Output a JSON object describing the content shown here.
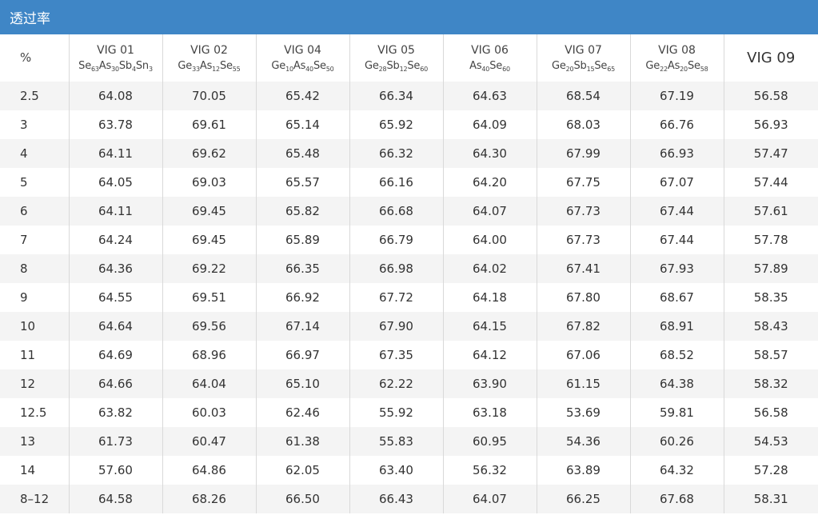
{
  "title": "透过率",
  "table": {
    "corner": "%",
    "columns": [
      {
        "name": "VIG 01",
        "formula": [
          [
            "Se",
            "63"
          ],
          [
            "As",
            "30"
          ],
          [
            "Sb",
            "4"
          ],
          [
            "Sn",
            "3"
          ]
        ]
      },
      {
        "name": "VIG 02",
        "formula": [
          [
            "Ge",
            "33"
          ],
          [
            "As",
            "12"
          ],
          [
            "Se",
            "55"
          ]
        ]
      },
      {
        "name": "VIG 04",
        "formula": [
          [
            "Ge",
            "10"
          ],
          [
            "As",
            "40"
          ],
          [
            "Se",
            "50"
          ]
        ]
      },
      {
        "name": "VIG 05",
        "formula": [
          [
            "Ge",
            "28"
          ],
          [
            "Sb",
            "12"
          ],
          [
            "Se",
            "60"
          ]
        ]
      },
      {
        "name": "VIG 06",
        "formula": [
          [
            "As",
            "40"
          ],
          [
            "Se",
            "60"
          ]
        ]
      },
      {
        "name": "VIG 07",
        "formula": [
          [
            "Ge",
            "20"
          ],
          [
            "Sb",
            "15"
          ],
          [
            "Se",
            "65"
          ]
        ]
      },
      {
        "name": "VIG 08",
        "formula": [
          [
            "Ge",
            "22"
          ],
          [
            "As",
            "20"
          ],
          [
            "Se",
            "58"
          ]
        ]
      },
      {
        "name": "VIG 09",
        "formula": []
      }
    ],
    "rows": [
      {
        "label": "2.5",
        "values": [
          "64.08",
          "70.05",
          "65.42",
          "66.34",
          "64.63",
          "68.54",
          "67.19",
          "56.58"
        ]
      },
      {
        "label": "3",
        "values": [
          "63.78",
          "69.61",
          "65.14",
          "65.92",
          "64.09",
          "68.03",
          "66.76",
          "56.93"
        ]
      },
      {
        "label": "4",
        "values": [
          "64.11",
          "69.62",
          "65.48",
          "66.32",
          "64.30",
          "67.99",
          "66.93",
          "57.47"
        ]
      },
      {
        "label": "5",
        "values": [
          "64.05",
          "69.03",
          "65.57",
          "66.16",
          "64.20",
          "67.75",
          "67.07",
          "57.44"
        ]
      },
      {
        "label": "6",
        "values": [
          "64.11",
          "69.45",
          "65.82",
          "66.68",
          "64.07",
          "67.73",
          "67.44",
          "57.61"
        ]
      },
      {
        "label": "7",
        "values": [
          "64.24",
          "69.45",
          "65.89",
          "66.79",
          "64.00",
          "67.73",
          "67.44",
          "57.78"
        ]
      },
      {
        "label": "8",
        "values": [
          "64.36",
          "69.22",
          "66.35",
          "66.98",
          "64.02",
          "67.41",
          "67.93",
          "57.89"
        ]
      },
      {
        "label": "9",
        "values": [
          "64.55",
          "69.51",
          "66.92",
          "67.72",
          "64.18",
          "67.80",
          "68.67",
          "58.35"
        ]
      },
      {
        "label": "10",
        "values": [
          "64.64",
          "69.56",
          "67.14",
          "67.90",
          "64.15",
          "67.82",
          "68.91",
          "58.43"
        ]
      },
      {
        "label": "11",
        "values": [
          "64.69",
          "68.96",
          "66.97",
          "67.35",
          "64.12",
          "67.06",
          "68.52",
          "58.57"
        ]
      },
      {
        "label": "12",
        "values": [
          "64.66",
          "64.04",
          "65.10",
          "62.22",
          "63.90",
          "61.15",
          "64.38",
          "58.32"
        ]
      },
      {
        "label": "12.5",
        "values": [
          "63.82",
          "60.03",
          "62.46",
          "55.92",
          "63.18",
          "53.69",
          "59.81",
          "56.58"
        ]
      },
      {
        "label": "13",
        "values": [
          "61.73",
          "60.47",
          "61.38",
          "55.83",
          "60.95",
          "54.36",
          "60.26",
          "54.53"
        ]
      },
      {
        "label": "14",
        "values": [
          "57.60",
          "64.86",
          "62.05",
          "63.40",
          "56.32",
          "63.89",
          "64.32",
          "57.28"
        ]
      },
      {
        "label": "8–12",
        "values": [
          "64.58",
          "68.26",
          "66.50",
          "66.43",
          "64.07",
          "66.25",
          "67.68",
          "58.31"
        ]
      }
    ]
  }
}
